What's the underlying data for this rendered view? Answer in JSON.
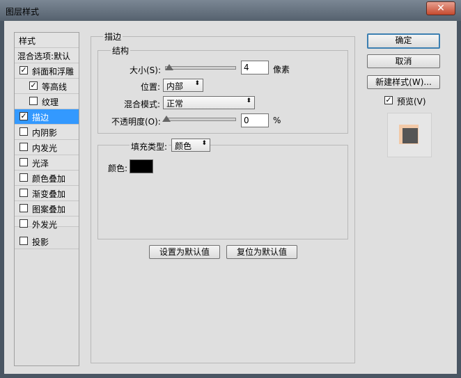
{
  "window": {
    "title": "图层样式",
    "close_glyph": "✕"
  },
  "sidebar": {
    "header": "样式",
    "blend_options": "混合选项:默认",
    "items": [
      {
        "label": "斜面和浮雕",
        "checked": true,
        "check_glyph": "✓"
      },
      {
        "label": "等高线",
        "checked": true,
        "check_glyph": "✓"
      },
      {
        "label": "纹理",
        "checked": false,
        "check_glyph": ""
      },
      {
        "label": "描边",
        "checked": true,
        "check_glyph": "✓"
      },
      {
        "label": "内阴影",
        "checked": false,
        "check_glyph": ""
      },
      {
        "label": "内发光",
        "checked": false,
        "check_glyph": ""
      },
      {
        "label": "光泽",
        "checked": false,
        "check_glyph": ""
      },
      {
        "label": "颜色叠加",
        "checked": false,
        "check_glyph": ""
      },
      {
        "label": "渐变叠加",
        "checked": false,
        "check_glyph": ""
      },
      {
        "label": "图案叠加",
        "checked": false,
        "check_glyph": ""
      },
      {
        "label": "外发光",
        "checked": false,
        "check_glyph": ""
      },
      {
        "label": "投影",
        "checked": false,
        "check_glyph": ""
      }
    ],
    "selected": "描边"
  },
  "stroke": {
    "section_title": "描边",
    "structure_title": "结构",
    "size_label": "大小(S):",
    "size_value": "4",
    "size_unit": "像素",
    "position_label": "位置:",
    "position_value": "内部",
    "blend_mode_label": "混合模式:",
    "blend_mode_value": "正常",
    "opacity_label": "不透明度(O):",
    "opacity_value": "0",
    "opacity_unit": "%",
    "fill_type_label": "填充类型:",
    "fill_type_value": "颜色",
    "color_label": "颜色:",
    "color_value": "#000000",
    "set_default": "设置为默认值",
    "reset_default": "复位为默认值"
  },
  "actions": {
    "ok": "确定",
    "cancel": "取消",
    "new_style": "新建样式(W)...",
    "preview_label": "预览(V)",
    "preview_checked": true,
    "preview_check_glyph": "✓"
  },
  "glyphs": {
    "updown": "⬍",
    "updown_icon": "up-down-arrows"
  }
}
